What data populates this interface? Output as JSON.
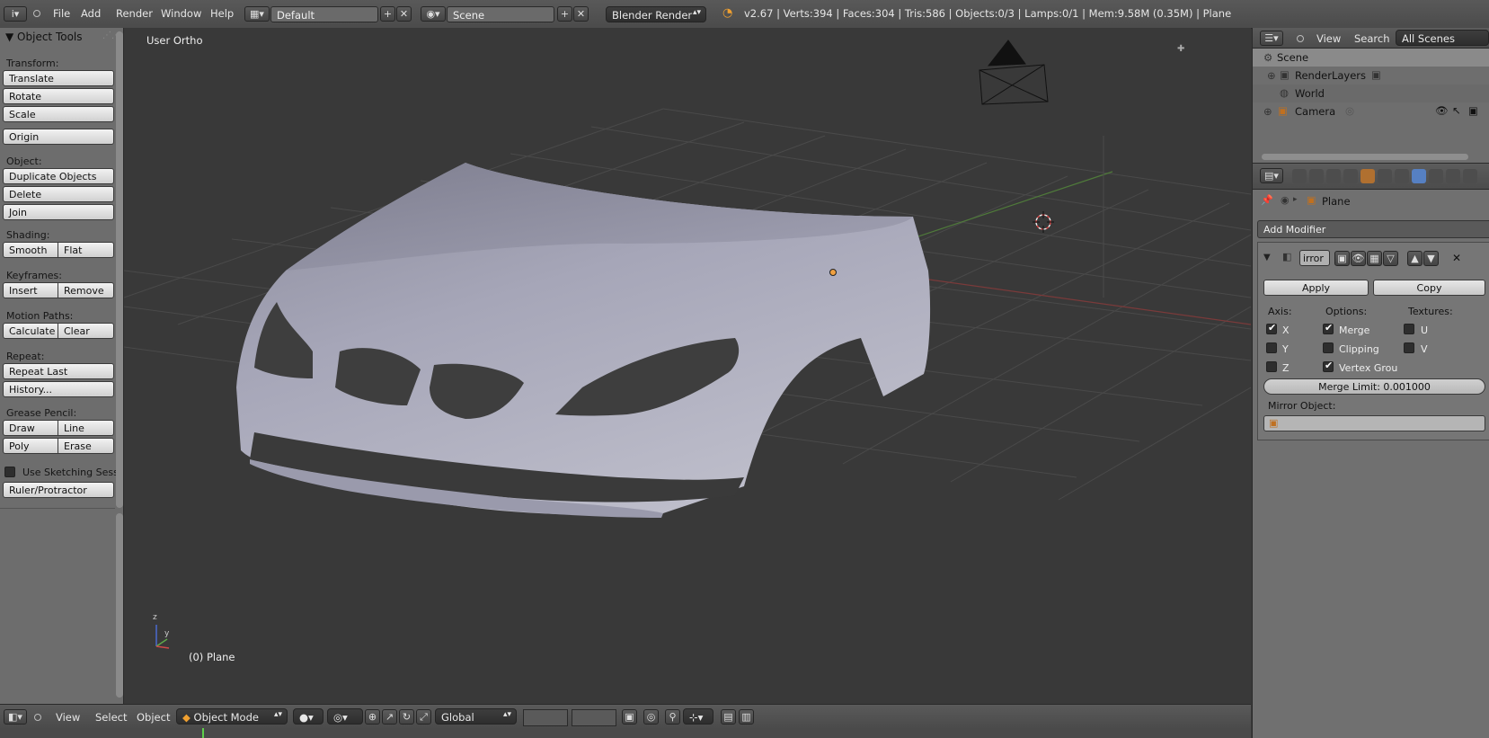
{
  "header": {
    "menus": [
      "File",
      "Add",
      "Render",
      "Window",
      "Help"
    ],
    "screen_layout": "Default",
    "scene": "Scene",
    "render_engine": "Blender Render",
    "stats": "v2.67 | Verts:394 | Faces:304 | Tris:586 | Objects:0/3 | Lamps:0/1 | Mem:9.58M (0.35M) | Plane"
  },
  "toolshelf": {
    "title": "Object Tools",
    "transform_label": "Transform:",
    "translate": "Translate",
    "rotate": "Rotate",
    "scale": "Scale",
    "origin": "Origin",
    "object_label": "Object:",
    "duplicate": "Duplicate Objects",
    "delete": "Delete",
    "join": "Join",
    "shading_label": "Shading:",
    "smooth": "Smooth",
    "flat": "Flat",
    "keyframes_label": "Keyframes:",
    "insert": "Insert",
    "remove": "Remove",
    "motion_label": "Motion Paths:",
    "calculate": "Calculate",
    "clear": "Clear",
    "repeat_label": "Repeat:",
    "repeat_last": "Repeat Last",
    "history": "History...",
    "grease_label": "Grease Pencil:",
    "draw": "Draw",
    "line": "Line",
    "poly": "Poly",
    "erase": "Erase",
    "sketching": "Use Sketching Sessi",
    "ruler": "Ruler/Protractor"
  },
  "viewport": {
    "view_name": "User Ortho",
    "object_label": "(0) Plane",
    "axis_z": "z",
    "axis_y": "y"
  },
  "bottombar": {
    "menus": [
      "View",
      "Select",
      "Object"
    ],
    "mode": "Object Mode",
    "orientation": "Global"
  },
  "outliner": {
    "menus": [
      "View",
      "Search"
    ],
    "filter": "All Scenes",
    "items": [
      "Scene",
      "RenderLayers",
      "World",
      "Camera"
    ]
  },
  "properties": {
    "object": "Plane",
    "add_modifier": "Add Modifier",
    "modifier_name": "irror",
    "apply": "Apply",
    "copy": "Copy",
    "axis_label": "Axis:",
    "options_label": "Options:",
    "textures_label": "Textures:",
    "axis_x": "X",
    "axis_y": "Y",
    "axis_z": "Z",
    "merge": "Merge",
    "clipping": "Clipping",
    "vertex_group": "Vertex Grou",
    "tex_u": "U",
    "tex_v": "V",
    "merge_limit": "Merge Limit: 0.001000",
    "mirror_object_label": "Mirror Object:"
  }
}
